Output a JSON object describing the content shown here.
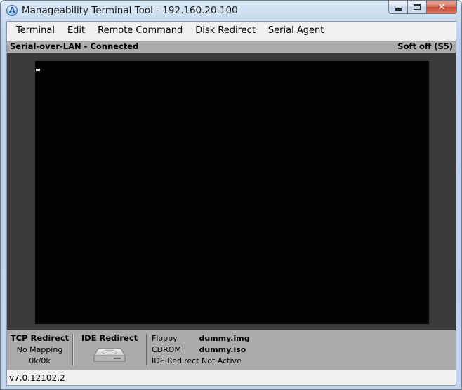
{
  "window": {
    "title": "Manageability Terminal Tool - 192.160.20.100",
    "icon": "app-logo-icon",
    "icon_letter": "A",
    "close_glyph": "✕"
  },
  "menu": {
    "items": [
      "Terminal",
      "Edit",
      "Remote Command",
      "Disk Redirect",
      "Serial Agent"
    ]
  },
  "status": {
    "left": "Serial-over-LAN - Connected",
    "right": "Soft off (S5)"
  },
  "terminal": {
    "background": "#000000",
    "cursor_color": "#e6e6e6"
  },
  "bottom": {
    "tcp": {
      "title": "TCP Redirect",
      "mapping": "No Mapping",
      "rate": "0k/0k"
    },
    "ide": {
      "title": "IDE Redirect",
      "icon": "disk-drive-icon"
    },
    "info": [
      {
        "label": "Floppy",
        "value": "dummy.img"
      },
      {
        "label": "CDROM",
        "value": "dummy.iso"
      },
      {
        "label": "IDE Redirect",
        "value": "Not Active"
      }
    ]
  },
  "footer": {
    "version": "v7.0.12102.2"
  }
}
